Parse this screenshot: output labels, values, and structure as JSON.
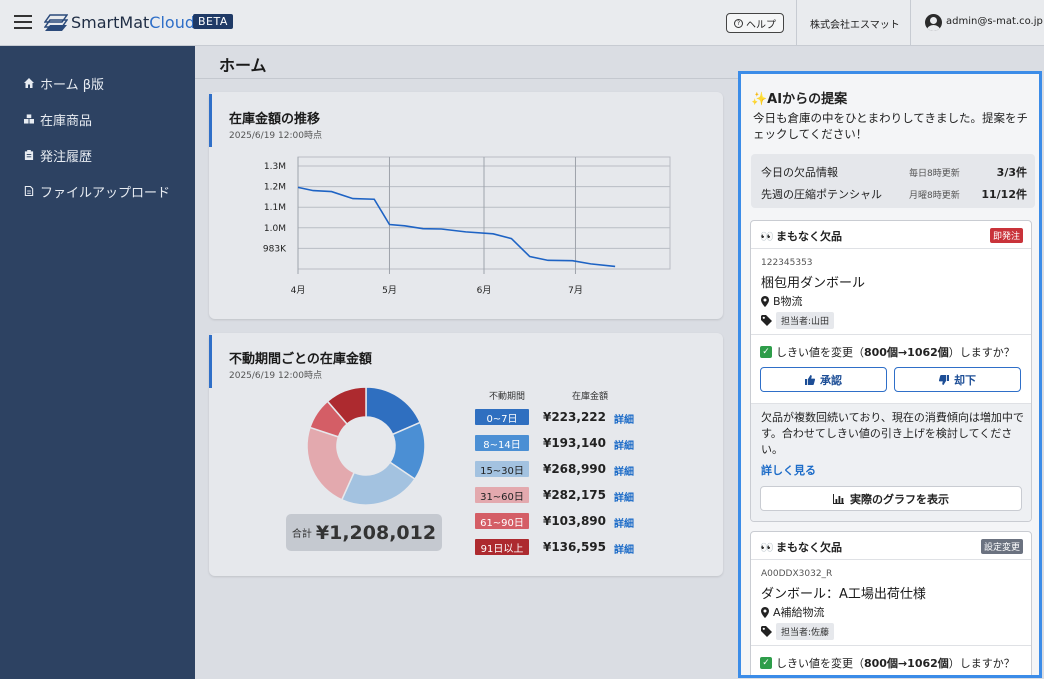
{
  "header": {
    "logo_main": "SmartMat",
    "logo_accent": "Cloud",
    "beta": "BETA",
    "help": "ヘルプ",
    "company": "株式会社エスマット",
    "email": "admin@s-mat.co.jp"
  },
  "sidebar": {
    "items": [
      {
        "label": "ホーム β版",
        "icon": "home-icon"
      },
      {
        "label": "在庫商品",
        "icon": "boxes-icon"
      },
      {
        "label": "発注履歴",
        "icon": "clipboard-icon"
      },
      {
        "label": "ファイルアップロード",
        "icon": "file-icon"
      }
    ]
  },
  "main": {
    "title": "ホーム",
    "trend": {
      "title": "在庫金額の推移",
      "subtitle": "2025/6/19 12:00時点"
    },
    "aging": {
      "title": "不動期間ごとの在庫金額",
      "subtitle": "2025/6/19 12:00時点",
      "col_period": "不動期間",
      "col_amount": "在庫金額",
      "total_label": "合計",
      "total_value": "¥1,208,012",
      "rows": [
        {
          "period": "0~7日",
          "amount": "¥223,222",
          "link": "詳細",
          "color": "#2f6fc0"
        },
        {
          "period": "8~14日",
          "amount": "¥193,140",
          "link": "詳細",
          "color": "#4b8fd4"
        },
        {
          "period": "15~30日",
          "amount": "¥268,990",
          "link": "詳細",
          "color": "#a3c2e0",
          "dark_text": true
        },
        {
          "period": "31~60日",
          "amount": "¥282,175",
          "link": "詳細",
          "color": "#e3a9ae",
          "dark_text": true
        },
        {
          "period": "61~90日",
          "amount": "¥103,890",
          "link": "詳細",
          "color": "#d45e66"
        },
        {
          "period": "91日以上",
          "amount": "¥136,595",
          "link": "詳細",
          "color": "#ad2a2f"
        }
      ]
    }
  },
  "chart_data": [
    {
      "type": "line",
      "title": "在庫金額の推移",
      "x_tick_labels": [
        "4月",
        "5月",
        "6月",
        "7月"
      ],
      "y_tick_labels": [
        "1.3M",
        "1.2M",
        "1.1M",
        "1.0M",
        "983K"
      ],
      "ylim": [
        950000,
        1300000
      ],
      "grid": true,
      "series": [
        {
          "color": "#1e63c4",
          "points": [
            {
              "x": "2025-04-01",
              "y": 1205000
            },
            {
              "x": "2025-04-06",
              "y": 1195000
            },
            {
              "x": "2025-04-12",
              "y": 1192000
            },
            {
              "x": "2025-04-19",
              "y": 1170000
            },
            {
              "x": "2025-04-26",
              "y": 1168000
            },
            {
              "x": "2025-05-01",
              "y": 1089000
            },
            {
              "x": "2025-05-06",
              "y": 1085000
            },
            {
              "x": "2025-05-12",
              "y": 1076000
            },
            {
              "x": "2025-05-18",
              "y": 1075000
            },
            {
              "x": "2025-05-26",
              "y": 1066000
            },
            {
              "x": "2025-06-04",
              "y": 1060000
            },
            {
              "x": "2025-06-10",
              "y": 1045000
            },
            {
              "x": "2025-06-16",
              "y": 989000
            },
            {
              "x": "2025-06-22",
              "y": 977000
            },
            {
              "x": "2025-06-30",
              "y": 976000
            },
            {
              "x": "2025-07-06",
              "y": 966000
            },
            {
              "x": "2025-07-14",
              "y": 958000
            }
          ]
        }
      ]
    },
    {
      "type": "pie",
      "title": "不動期間ごとの在庫金額",
      "donut": true,
      "categories": [
        "0~7日",
        "8~14日",
        "15~30日",
        "31~60日",
        "61~90日",
        "91日以上"
      ],
      "values": [
        223222,
        193140,
        268990,
        282175,
        103890,
        136595
      ],
      "colors": [
        "#2f6fc0",
        "#4b8fd4",
        "#a3c2e0",
        "#e3a9ae",
        "#d45e66",
        "#ad2a2f"
      ]
    }
  ],
  "ai": {
    "title": "✨AIからの提案",
    "message": "今日も倉庫の中をひとまわりしてきました。提案をチェックしてください！",
    "info": [
      {
        "label": "今日の欠品情報",
        "update": "毎日8時更新",
        "count": "3/3件"
      },
      {
        "label": "先週の圧縮ポテンシャル",
        "update": "月曜8時更新",
        "count": "11/12件"
      }
    ],
    "cards": [
      {
        "heading": "まもなく欠品",
        "badge": "即発注",
        "sku": "122345353",
        "name": "梱包用ダンボール",
        "location": "B物流",
        "tag": "担当者:山田",
        "question_pre": "しきい値を変更（",
        "question_bold": "800個→1062個",
        "question_post": "）しますか？",
        "approve": "承認",
        "reject": "却下",
        "description": "欠品が複数回続いており、現在の消費傾向は増加中です。合わせてしきい値の引き上げを検討してください。",
        "more": "詳しく見る",
        "graph_button": "実際のグラフを表示"
      },
      {
        "heading": "まもなく欠品",
        "badge": "設定変更",
        "sku": "A00DDX3032_R",
        "name": "ダンボール：A工場出荷仕様",
        "location": "A補給物流",
        "tag": "担当者:佐藤",
        "question_pre": "しきい値を変更（",
        "question_bold": "800個→1062個",
        "question_post": "）しますか？"
      }
    ]
  }
}
